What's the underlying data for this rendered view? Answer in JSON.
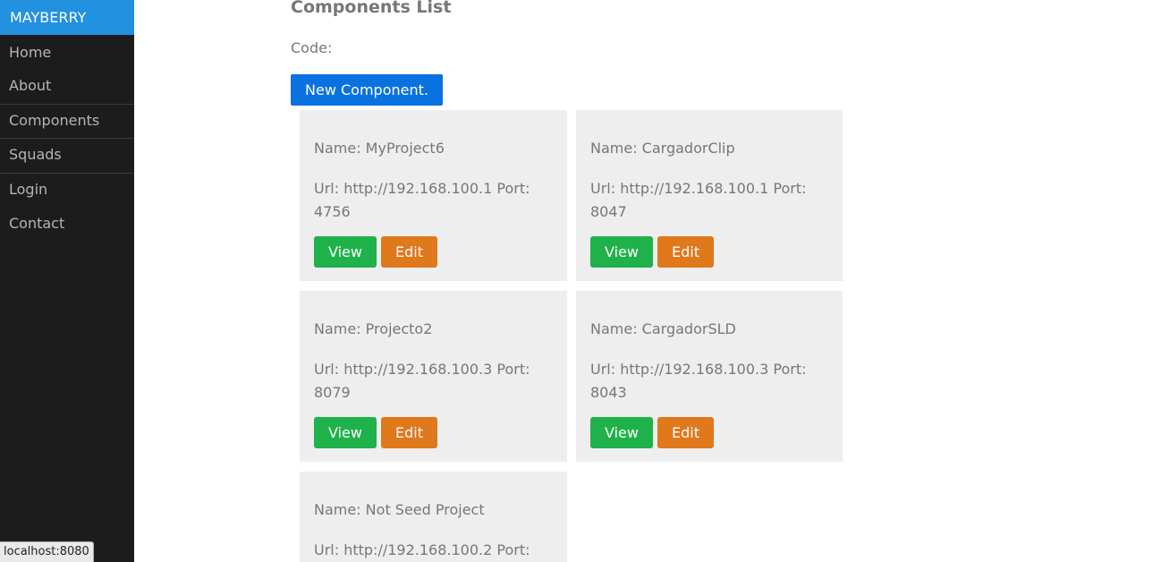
{
  "sidebar": {
    "brand": "MAYBERRY",
    "items": [
      {
        "label": "Home"
      },
      {
        "label": "About"
      },
      {
        "label": "Components"
      },
      {
        "label": "Squads"
      },
      {
        "label": "Login"
      },
      {
        "label": "Contact"
      }
    ]
  },
  "main": {
    "title": "Components List",
    "code_label": "Code:",
    "new_button_label": "New Component."
  },
  "components": [
    {
      "name": "Name: MyProject6",
      "url": "Url: http://192.168.100.1 Port: 4756",
      "view_label": "View",
      "edit_label": "Edit"
    },
    {
      "name": "Name: CargadorClip",
      "url": "Url: http://192.168.100.1 Port: 8047",
      "view_label": "View",
      "edit_label": "Edit"
    },
    {
      "name": "Name: Projecto2",
      "url": "Url: http://192.168.100.3 Port: 8079",
      "view_label": "View",
      "edit_label": "Edit"
    },
    {
      "name": "Name: CargadorSLD",
      "url": "Url: http://192.168.100.3 Port: 8043",
      "view_label": "View",
      "edit_label": "Edit"
    },
    {
      "name": "Name: Not Seed Project",
      "url": "Url: http://192.168.100.2 Port:",
      "view_label": "",
      "edit_label": ""
    }
  ],
  "status_bar": {
    "text": "localhost:8080"
  },
  "colors": {
    "sidebar_bg": "#1c1c1c",
    "brand_bg": "#2191e0",
    "primary_button": "#0a72e0",
    "view_button": "#1fb24a",
    "edit_button": "#e0781c",
    "card_bg": "#eeeeee"
  }
}
